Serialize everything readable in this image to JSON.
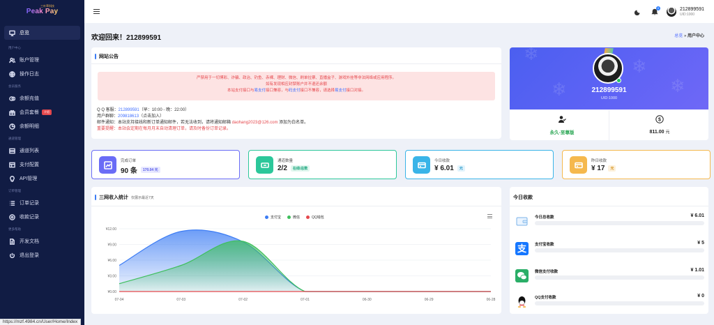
{
  "brand": {
    "top": "三叶草科技",
    "name": "Peak Pay"
  },
  "sidebar": {
    "active": {
      "label": "总览"
    },
    "sections": {
      "user_center": "用户中心",
      "member_service": "会员服务",
      "channel_manage": "通道管理",
      "order_manage": "订单管理",
      "more_help": "更多帮助"
    },
    "items": {
      "account": "账户管理",
      "oplog": "操作日志",
      "recharge": "余额充值",
      "package": "会员套餐",
      "balance": "余额明细",
      "channels": "通道列表",
      "pay_config": "支付配置",
      "api": "API管理",
      "orders": "订单记录",
      "collect": "收款记录",
      "docs": "开发文档",
      "logout": "退出登录"
    },
    "package_badge": "介绍"
  },
  "topbar": {
    "bell_count": "0",
    "username": "212899591",
    "uid": "UID:1000"
  },
  "page": {
    "welcome": "欢迎回来！212899591",
    "breadcrumb_home": "总览",
    "breadcrumb_sep": "»",
    "breadcrumb_current": "用户中心"
  },
  "notice": {
    "title": "网站公告",
    "line1": "严禁用于一切博彩、诈骗、政治、钓鱼、赤裸、理财、微信、刷单拉票、直播盒子、游戏外挂等非法网络或应用程序。",
    "line2": "如有发现相应封禁账户并不退还余额",
    "line3a": "本站支付接口与",
    "line3b": "易支付",
    "line3c": "接口兼容，与",
    "line3d": "码支付",
    "line3e": "接口不兼容，请选择",
    "line3f": "易支付",
    "line3g": "接口对接。",
    "qq_label": "Q Q 客服：",
    "qq_value": "212899591",
    "qq_hours": "（早：10:00 - 晚：22:00）",
    "group_label": "用户群聊：",
    "group_value": "209818613",
    "group_note": "（点击加入）",
    "mail_label": "邮件通知：本站支持接线和新订单通知邮件，若无法收到，请将通知邮箱 ",
    "mail_value": "daohang2023@126.com",
    "mail_note": " 添加为白名单。",
    "important": "重要提醒：本站会定期在每月月末自动清理订单，请及时备份订单记录。"
  },
  "profile": {
    "name": "212899591",
    "uid": "UID:1000",
    "vip_label": "永久-至尊版",
    "balance": "811.00",
    "balance_unit": "元"
  },
  "stats": [
    {
      "label": "完成订单",
      "value": "90 条",
      "tag": "170.04 元",
      "color": "#6a6cf6",
      "tag_bg": "#e8e9ff",
      "tag_color": "#5558e8"
    },
    {
      "label": "通道数量",
      "value": "2/2",
      "tag": "在线/总数",
      "color": "#2cc79a",
      "tag_bg": "#e2f7ef",
      "tag_color": "#16a37a"
    },
    {
      "label": "今日收款",
      "value": "¥ 6.01",
      "tag": "元",
      "color": "#39b4e8",
      "tag_bg": "#e3f4fc",
      "tag_color": "#1f94c7"
    },
    {
      "label": "昨日收款",
      "value": "¥ 17",
      "tag": "元",
      "color": "#f5b84d",
      "tag_bg": "#fdf1dd",
      "tag_color": "#d38d12"
    }
  ],
  "chart": {
    "title": "三网收入统计",
    "subtitle": "仅展示最近7天"
  },
  "chart_data": {
    "type": "area",
    "categories": [
      "07-04",
      "07-03",
      "07-02",
      "07-01",
      "06-30",
      "06-29",
      "06-28"
    ],
    "ylim": [
      0,
      12
    ],
    "yticks": [
      "¥0.00",
      "¥3.00",
      "¥6.00",
      "¥9.00",
      "¥12.00"
    ],
    "series": [
      {
        "name": "支付宝",
        "color": "#3c7cf4",
        "values": [
          5,
          11.5,
          9.5,
          0,
          0,
          0,
          0
        ]
      },
      {
        "name": "微信",
        "color": "#3fbf5d",
        "values": [
          1.5,
          5,
          9.6,
          0,
          0,
          0,
          0
        ]
      },
      {
        "name": "QQ钱包",
        "color": "#e5484d",
        "values": [
          0,
          0,
          0,
          0,
          0,
          0,
          0
        ]
      }
    ],
    "grid": true,
    "legend": "top-center"
  },
  "today": {
    "title": "今日收款",
    "rows": [
      {
        "label": "今日总收款",
        "amount": "¥ 6.01"
      },
      {
        "label": "支付宝收款",
        "amount": "¥ 5"
      },
      {
        "label": "微信支付收款",
        "amount": "¥ 1.01"
      },
      {
        "label": "QQ支付收款",
        "amount": "¥ 0"
      }
    ]
  },
  "status": {
    "url": "https://mzf.4984.cn/User/Home/Index"
  }
}
